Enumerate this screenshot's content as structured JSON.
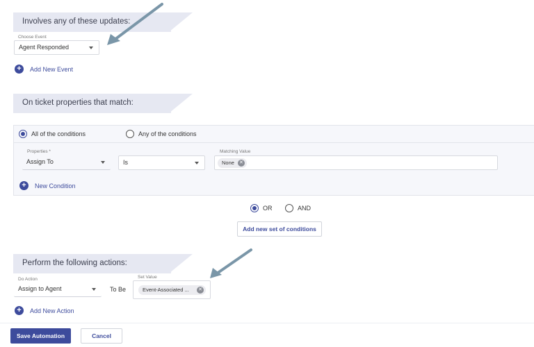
{
  "updates_section": {
    "title": "Involves any of these updates:",
    "choose_event_label": "Choose Event",
    "selected_event": "Agent Responded",
    "add_event_label": "Add New Event"
  },
  "ticket_section": {
    "title": "On ticket properties that match:",
    "match_options": [
      {
        "label": "All of the conditions",
        "checked": true
      },
      {
        "label": "Any of the conditions",
        "checked": false
      }
    ],
    "properties_label": "Properties *",
    "property_value": "Assign To",
    "operator_value": "Is",
    "matching_value_label": "Matching Value",
    "matching_chip": "None",
    "new_condition_label": "New Condition"
  },
  "logic": {
    "or_label": "OR",
    "and_label": "AND",
    "selected": "OR",
    "add_set_label": "Add new set of conditions"
  },
  "actions_section": {
    "title": "Perform the following actions:",
    "do_action_label": "Do Action",
    "action_value": "Assign to Agent",
    "to_be_label": "To Be",
    "set_value_label": "Set Value",
    "set_value_chip": "Event-Associated ...",
    "add_action_label": "Add New Action"
  },
  "footer": {
    "save_label": "Save Automation",
    "cancel_label": "Cancel"
  },
  "colors": {
    "primary": "#3d4b9c",
    "header_band": "#e6e8f2",
    "annotation_arrow": "#7a96a8"
  }
}
